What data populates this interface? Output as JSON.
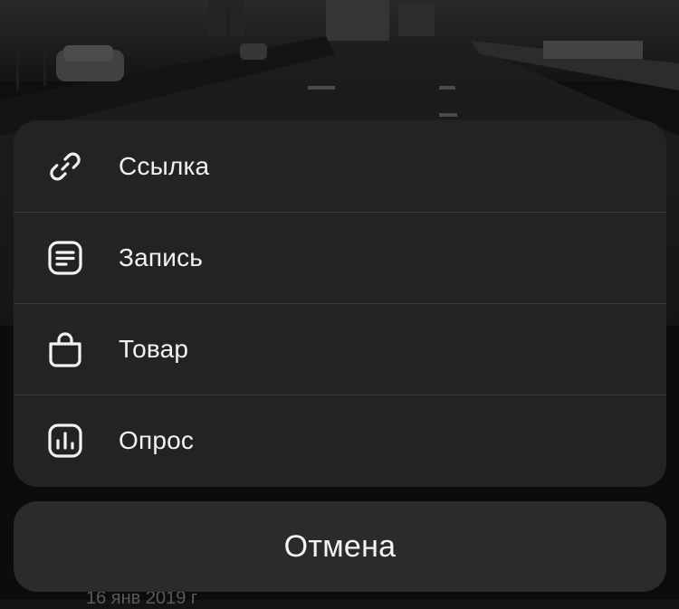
{
  "action_sheet": {
    "items": [
      {
        "label": "Ссылка",
        "icon": "link-icon"
      },
      {
        "label": "Запись",
        "icon": "document-icon"
      },
      {
        "label": "Товар",
        "icon": "shopping-bag-icon"
      },
      {
        "label": "Опрос",
        "icon": "poll-chart-icon"
      }
    ],
    "cancel_label": "Отмена"
  },
  "background": {
    "peek_text": "16 янв 2019 г"
  },
  "colors": {
    "sheet": "#232323",
    "cancel_button": "#2b2b2b",
    "text": "#f2f2f2",
    "separator": "#3a3a3a"
  }
}
